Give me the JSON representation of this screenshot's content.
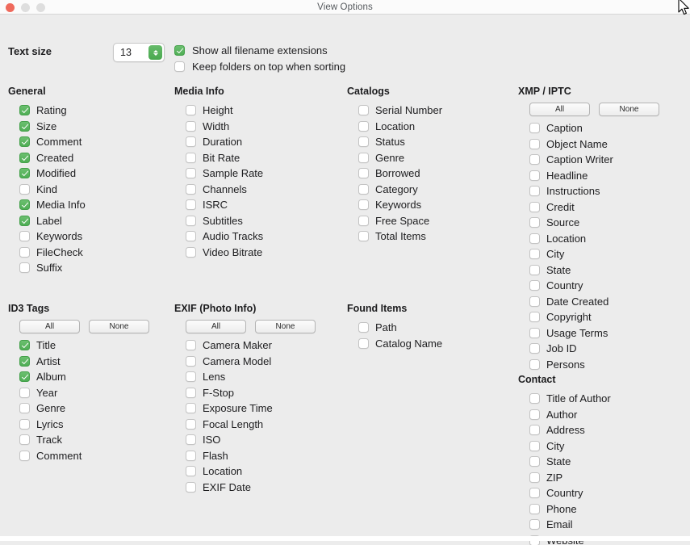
{
  "window": {
    "title": "View Options",
    "traffic_lights": [
      "close-button",
      "minimize-button",
      "maximize-button"
    ]
  },
  "top": {
    "text_size_label": "Text size",
    "text_size_value": "13",
    "options": [
      {
        "label": "Show all filename extensions",
        "checked": true
      },
      {
        "label": "Keep folders on top when sorting",
        "checked": false
      }
    ]
  },
  "buttons": {
    "all": "All",
    "none": "None"
  },
  "colors": {
    "accent_green": "#4fae55",
    "window_bg": "#ececec",
    "titlebar_bg": "#fbfbfb",
    "text": "#1d1d1f",
    "close_light": "#ef6a5c",
    "inactive_light": "#dedede"
  },
  "groups": {
    "general": {
      "heading": "General",
      "items": [
        {
          "label": "Rating",
          "checked": true
        },
        {
          "label": "Size",
          "checked": true
        },
        {
          "label": "Comment",
          "checked": true
        },
        {
          "label": "Created",
          "checked": true
        },
        {
          "label": "Modified",
          "checked": true
        },
        {
          "label": "Kind",
          "checked": false
        },
        {
          "label": "Media Info",
          "checked": true
        },
        {
          "label": "Label",
          "checked": true
        },
        {
          "label": "Keywords",
          "checked": false
        },
        {
          "label": "FileCheck",
          "checked": false
        },
        {
          "label": "Suffix",
          "checked": false
        }
      ]
    },
    "media_info": {
      "heading": "Media Info",
      "items": [
        {
          "label": "Height",
          "checked": false
        },
        {
          "label": "Width",
          "checked": false
        },
        {
          "label": "Duration",
          "checked": false
        },
        {
          "label": "Bit Rate",
          "checked": false
        },
        {
          "label": "Sample Rate",
          "checked": false
        },
        {
          "label": "Channels",
          "checked": false
        },
        {
          "label": "ISRC",
          "checked": false
        },
        {
          "label": "Subtitles",
          "checked": false
        },
        {
          "label": "Audio Tracks",
          "checked": false
        },
        {
          "label": "Video Bitrate",
          "checked": false
        }
      ]
    },
    "catalogs": {
      "heading": "Catalogs",
      "items": [
        {
          "label": "Serial Number",
          "checked": false
        },
        {
          "label": "Location",
          "checked": false
        },
        {
          "label": "Status",
          "checked": false
        },
        {
          "label": "Genre",
          "checked": false
        },
        {
          "label": "Borrowed",
          "checked": false
        },
        {
          "label": "Category",
          "checked": false
        },
        {
          "label": "Keywords",
          "checked": false
        },
        {
          "label": "Free Space",
          "checked": false
        },
        {
          "label": "Total Items",
          "checked": false
        }
      ]
    },
    "xmp_iptc": {
      "heading": "XMP / IPTC",
      "has_buttons": true,
      "items": [
        {
          "label": "Caption",
          "checked": false
        },
        {
          "label": "Object Name",
          "checked": false
        },
        {
          "label": "Caption Writer",
          "checked": false
        },
        {
          "label": "Headline",
          "checked": false
        },
        {
          "label": "Instructions",
          "checked": false
        },
        {
          "label": "Credit",
          "checked": false
        },
        {
          "label": "Source",
          "checked": false
        },
        {
          "label": "Location",
          "checked": false
        },
        {
          "label": "City",
          "checked": false
        },
        {
          "label": "State",
          "checked": false
        },
        {
          "label": "Country",
          "checked": false
        },
        {
          "label": "Date Created",
          "checked": false
        },
        {
          "label": "Copyright",
          "checked": false
        },
        {
          "label": "Usage Terms",
          "checked": false
        },
        {
          "label": "Job ID",
          "checked": false
        },
        {
          "label": "Persons",
          "checked": false
        }
      ]
    },
    "contact": {
      "heading": "Contact",
      "items": [
        {
          "label": "Title of Author",
          "checked": false
        },
        {
          "label": "Author",
          "checked": false
        },
        {
          "label": "Address",
          "checked": false
        },
        {
          "label": "City",
          "checked": false
        },
        {
          "label": "State",
          "checked": false
        },
        {
          "label": "ZIP",
          "checked": false
        },
        {
          "label": "Country",
          "checked": false
        },
        {
          "label": "Phone",
          "checked": false
        },
        {
          "label": "Email",
          "checked": false
        },
        {
          "label": "Website",
          "checked": false
        }
      ]
    },
    "id3_tags": {
      "heading": "ID3 Tags",
      "has_buttons": true,
      "items": [
        {
          "label": "Title",
          "checked": true
        },
        {
          "label": "Artist",
          "checked": true
        },
        {
          "label": "Album",
          "checked": true
        },
        {
          "label": "Year",
          "checked": false
        },
        {
          "label": "Genre",
          "checked": false
        },
        {
          "label": "Lyrics",
          "checked": false
        },
        {
          "label": "Track",
          "checked": false
        },
        {
          "label": "Comment",
          "checked": false
        }
      ]
    },
    "exif": {
      "heading": "EXIF (Photo Info)",
      "has_buttons": true,
      "items": [
        {
          "label": "Camera Maker",
          "checked": false
        },
        {
          "label": "Camera Model",
          "checked": false
        },
        {
          "label": "Lens",
          "checked": false
        },
        {
          "label": "F-Stop",
          "checked": false
        },
        {
          "label": "Exposure Time",
          "checked": false
        },
        {
          "label": "Focal Length",
          "checked": false
        },
        {
          "label": "ISO",
          "checked": false
        },
        {
          "label": "Flash",
          "checked": false
        },
        {
          "label": "Location",
          "checked": false
        },
        {
          "label": "EXIF Date",
          "checked": false
        }
      ]
    },
    "found_items": {
      "heading": "Found Items",
      "items": [
        {
          "label": "Path",
          "checked": false
        },
        {
          "label": "Catalog Name",
          "checked": false
        }
      ]
    }
  }
}
